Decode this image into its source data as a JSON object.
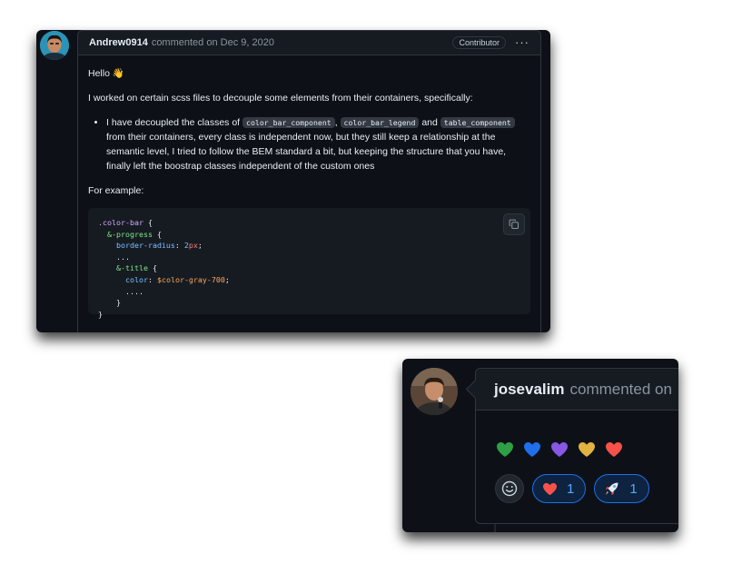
{
  "comment1": {
    "author": "Andrew0914",
    "meta": "commented on Dec 9, 2020",
    "badge": "Contributor",
    "menu_glyph": "···",
    "greeting": "Hello",
    "greeting_emoji": "👋",
    "intro": "I worked on certain scss files to decouple some elements from their containers, specifically:",
    "bullet": {
      "part1": "I have decoupled the classes of",
      "code1": "color_bar_component",
      "sep1": ",",
      "code2": "color_bar_legend",
      "sep2": "and",
      "code3": "table_component",
      "part2": "from their containers, every class is independent now, but they still keep a relationship at the semantic level, I tried to follow the BEM standard a bit, but keeping the structure that you have, finally left the boostrap classes independent of the custom ones"
    },
    "example_label": "For example:",
    "code": {
      "l1_sel": ".color-bar",
      "open": "{",
      "close": "}",
      "l2_sel": "&-progress",
      "l3_prop": "border-radius",
      "colon": ":",
      "l3_num": "2",
      "l3_unit": "px",
      "semicolon": ";",
      "ellipsis3": "...",
      "l5_sel": "&-title",
      "l6_prop": "color",
      "l6_var": "$color-gray-700",
      "ellipsis4": "...."
    }
  },
  "comment2": {
    "author": "josevalim",
    "meta": "commented on",
    "reactions": [
      {
        "emoji": "heart",
        "count": "1",
        "color": "#f85149"
      },
      {
        "emoji": "rocket",
        "count": "1",
        "color": "#58a6ff"
      }
    ],
    "hearts": [
      "#2ea043",
      "#1f6feb",
      "#8957e5",
      "#e3b341",
      "#f85149"
    ]
  },
  "colors": {
    "canvas": "#0d1117",
    "header": "#161b22",
    "border": "#30363d",
    "accent": "#58a6ff"
  }
}
